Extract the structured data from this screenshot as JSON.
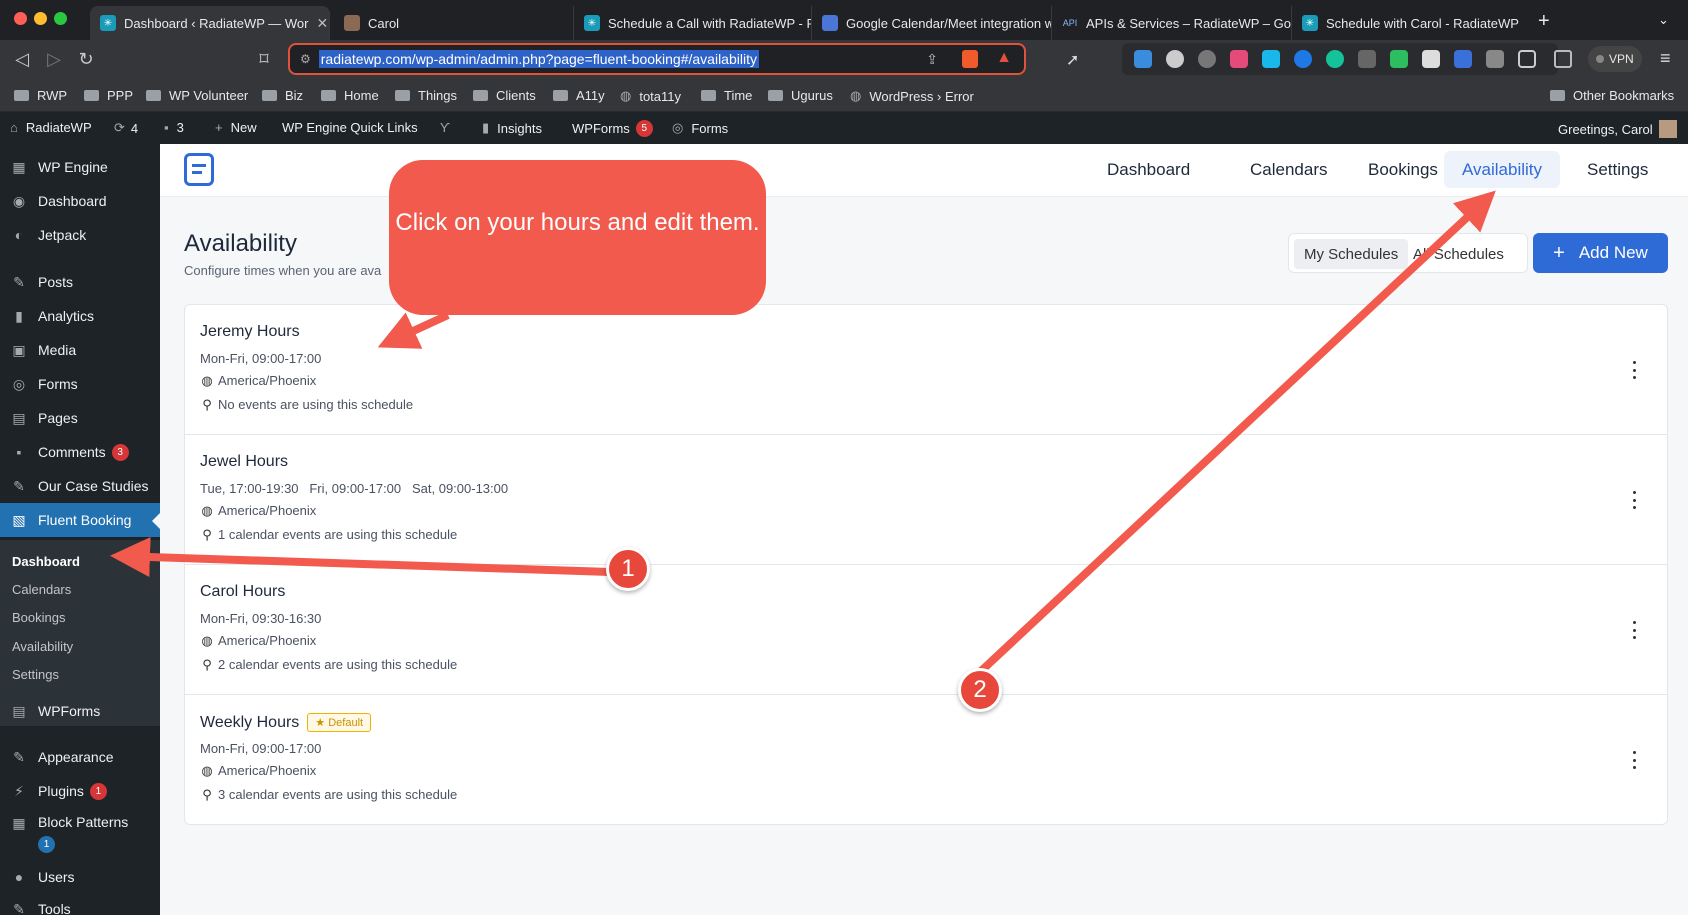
{
  "browser": {
    "tabs": [
      {
        "title": "Dashboard ‹ RadiateWP — Wor",
        "close": "✕"
      },
      {
        "title": "Carol"
      },
      {
        "title": "Schedule a Call with RadiateWP - Ra"
      },
      {
        "title": "Google Calendar/Meet integration w"
      },
      {
        "title": "APIs & Services – RadiateWP – Goo"
      },
      {
        "title": "Schedule with Carol - RadiateWP"
      }
    ],
    "new_tab": "+",
    "url": "radiatewp.com/wp-admin/admin.php?page=fluent-booking#/availability",
    "vpn_label": "VPN",
    "bookmarks": [
      "RWP",
      "PPP",
      "WP Volunteer",
      "Biz",
      "Home",
      "Things",
      "Clients",
      "A11y",
      "tota11y",
      "Time",
      "Ugurus",
      "WordPress › Error"
    ],
    "other_bookmarks": "Other Bookmarks"
  },
  "adminbar": {
    "site": "RadiateWP",
    "updates": "4",
    "comments": "3",
    "new": "New",
    "wpengine": "WP Engine Quick Links",
    "insights": "Insights",
    "wpforms": "WPForms",
    "wpforms_count": "5",
    "forms": "Forms",
    "greeting": "Greetings, Carol"
  },
  "sidebar": {
    "items": [
      {
        "label": "WP Engine"
      },
      {
        "label": "Dashboard"
      },
      {
        "label": "Jetpack"
      },
      {
        "label": "Posts"
      },
      {
        "label": "Analytics"
      },
      {
        "label": "Media"
      },
      {
        "label": "Forms"
      },
      {
        "label": "Pages"
      },
      {
        "label": "Comments",
        "badge": "3"
      },
      {
        "label": "Our Case Studies"
      },
      {
        "label": "Fluent Booking"
      },
      {
        "label": "WPForms"
      },
      {
        "label": "Appearance"
      },
      {
        "label": "Plugins",
        "badge": "1"
      },
      {
        "label": "Block Patterns",
        "badge": "1"
      },
      {
        "label": "Users"
      },
      {
        "label": "Tools"
      }
    ],
    "submenu": [
      "Dashboard",
      "Calendars",
      "Bookings",
      "Availability",
      "Settings"
    ]
  },
  "topnav": [
    "Dashboard",
    "Calendars",
    "Bookings",
    "Availability",
    "Settings"
  ],
  "page": {
    "title": "Availability",
    "subtitle": "Configure times when you are ava",
    "seg_my": "My Schedules",
    "seg_all": "All Schedules",
    "add_new": "Add New",
    "add_icon": "+"
  },
  "schedules": [
    {
      "name": "Jeremy Hours",
      "times": "Mon-Fri, 09:00-17:00",
      "tz": "America/Phoenix",
      "usage": "No events are using this schedule"
    },
    {
      "name": "Jewel Hours",
      "times": "Tue, 17:00-19:30   Fri, 09:00-17:00   Sat, 09:00-13:00",
      "tz": "America/Phoenix",
      "usage": "1 calendar events are using this schedule"
    },
    {
      "name": "Carol Hours",
      "times": "Mon-Fri, 09:30-16:30",
      "tz": "America/Phoenix",
      "usage": "2 calendar events are using this schedule"
    },
    {
      "name": "Weekly Hours",
      "default": "★ Default",
      "times": "Mon-Fri, 09:00-17:00",
      "tz": "America/Phoenix",
      "usage": "3 calendar events are using this schedule"
    }
  ],
  "annotation": {
    "callout": "Click on your hours and edit them.",
    "marker1": "1",
    "marker2": "2",
    "color": "#f15a4d"
  }
}
